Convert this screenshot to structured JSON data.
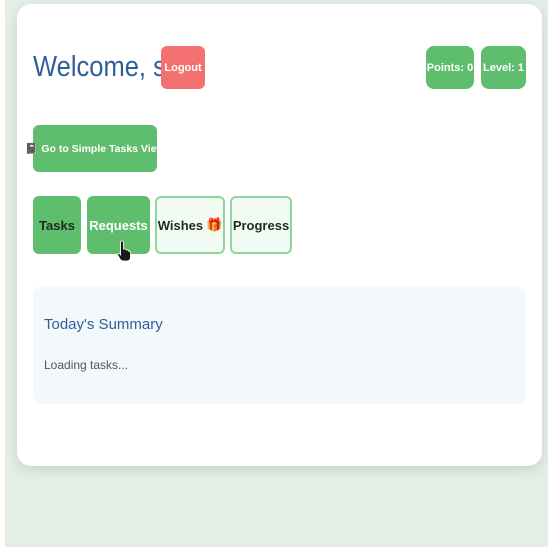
{
  "header": {
    "welcome_text": "Welcome, s",
    "wave_icon": "👋",
    "logout_label": "Logout",
    "points_label": "Points: 0",
    "level_label": "Level: 1"
  },
  "actions": {
    "simple_view_label": "📓 Go to Simple Tasks View"
  },
  "tabs": [
    {
      "label": "Tasks",
      "active": false
    },
    {
      "label": "Requests",
      "active": true
    },
    {
      "label": "Wishes",
      "icon": "🎁",
      "active": false
    },
    {
      "label": "Progress",
      "active": false
    }
  ],
  "summary": {
    "title": "Today's Summary",
    "status_text": "Loading tasks..."
  },
  "colors": {
    "accent_green": "#5fbe6e",
    "logout_red": "#f47171",
    "title_blue": "#2f5f9a",
    "backdrop": "#e3efe6"
  }
}
